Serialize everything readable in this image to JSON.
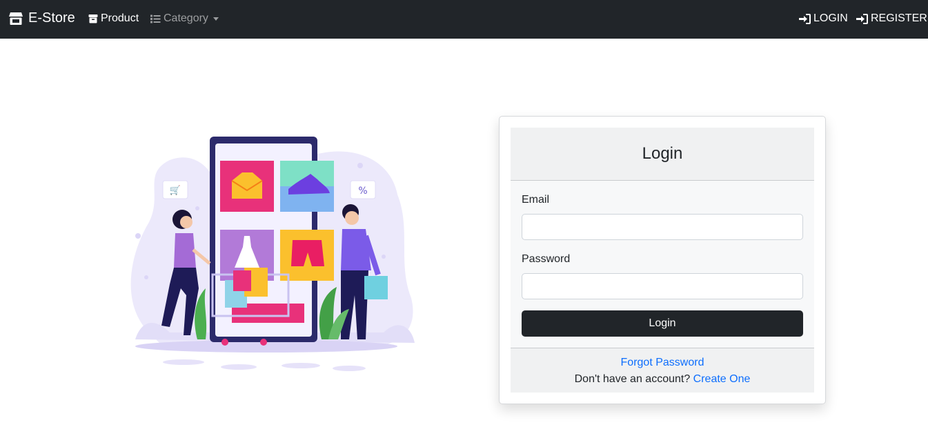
{
  "navbar": {
    "brand": "E-Store",
    "product": "Product",
    "category": "Category",
    "login": "LOGIN",
    "register": "REGISTER"
  },
  "illustration": {
    "alt_icons": [
      "shopping-cart-bubble",
      "percent-bubble"
    ],
    "bubble_percent": "%"
  },
  "login_card": {
    "title": "Login",
    "email_label": "Email",
    "email_value": "",
    "password_label": "Password",
    "password_value": "",
    "submit_label": "Login",
    "forgot_password": "Forgot Password",
    "no_account_text": "Don't have an account?",
    "create_one": "Create One"
  },
  "colors": {
    "navbar_bg": "#212529",
    "link": "#0d6efd",
    "button_bg": "#212529"
  }
}
